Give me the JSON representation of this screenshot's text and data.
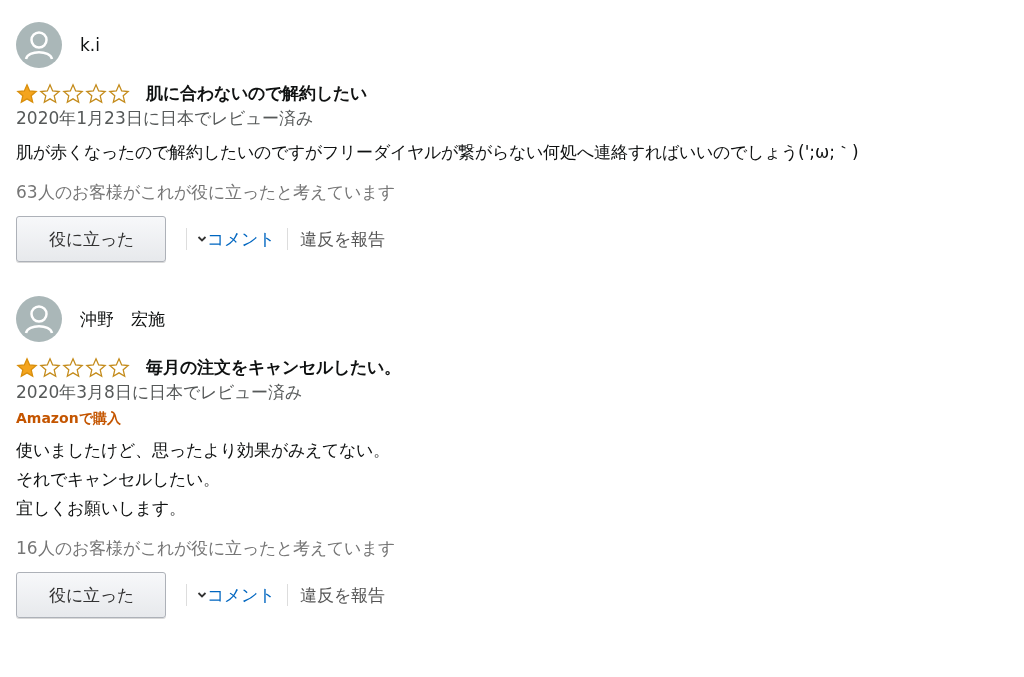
{
  "reviews": [
    {
      "author": "k.i",
      "stars": 1,
      "title": "肌に合わないので解約したい",
      "date": "2020年1月23日に日本でレビュー済み",
      "body": [
        "肌が赤くなったので解約したいのですがフリーダイヤルが繋がらない何処へ連絡すればいいのでしょう(';ω;｀)"
      ],
      "helpful_count": "63人のお客様がこれが役に立ったと考えています",
      "helpful_button": "役に立った",
      "comment_link": "コメント",
      "report_link": "違反を報告"
    },
    {
      "author": "沖野　宏施",
      "stars": 1,
      "title": "毎月の注文をキャンセルしたい。",
      "date": "2020年3月8日に日本でレビュー済み",
      "badge": "Amazonで購入",
      "body": [
        "使いましたけど、思ったより効果がみえてない。",
        "それでキャンセルしたい。",
        "宜しくお願いします。"
      ],
      "helpful_count": "16人のお客様がこれが役に立ったと考えています",
      "helpful_button": "役に立った",
      "comment_link": "コメント",
      "report_link": "違反を報告"
    }
  ]
}
